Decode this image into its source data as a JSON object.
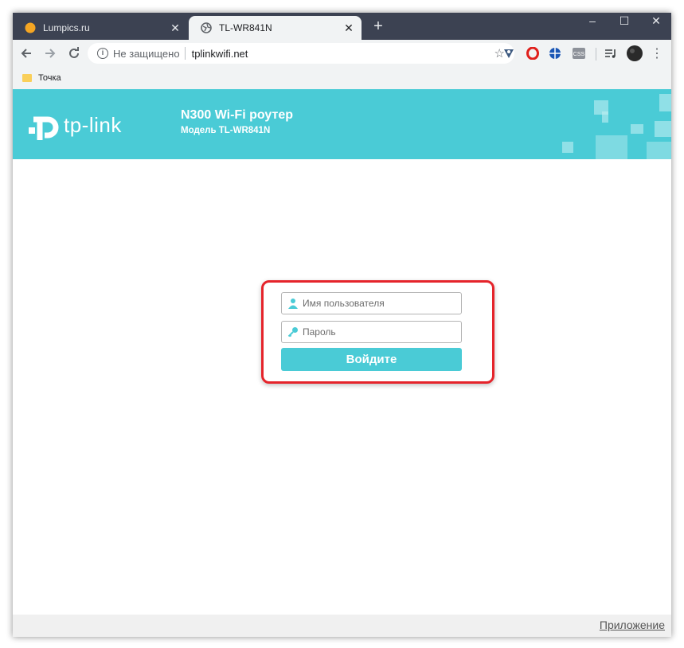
{
  "browser": {
    "tabs": [
      {
        "title": "Lumpics.ru",
        "favicon": "lumpics-icon",
        "active": false
      },
      {
        "title": "TL-WR841N",
        "favicon": "globe-icon",
        "active": true
      }
    ],
    "new_tab": "+",
    "window_controls": {
      "minimize": "–",
      "maximize": "☐",
      "close": "✕"
    },
    "address": {
      "security_text": "Не защищено",
      "url": "tplinkwifi.net"
    },
    "bookmarks": [
      {
        "label": "Точка"
      }
    ],
    "extension_icons": [
      "vpn-icon",
      "opera-icon",
      "globe-extension-icon",
      "css-icon",
      "playlist-icon",
      "profile-avatar"
    ]
  },
  "router": {
    "brand": "tp-link",
    "title": "N300 Wi-Fi роутер",
    "model": "Модель TL-WR841N",
    "accent_color": "#4acbd6"
  },
  "login": {
    "username_placeholder": "Имя пользователя",
    "password_placeholder": "Пароль",
    "submit_label": "Войдите",
    "highlight_color": "#e5242b"
  },
  "footer": {
    "app_link": "Приложение"
  }
}
